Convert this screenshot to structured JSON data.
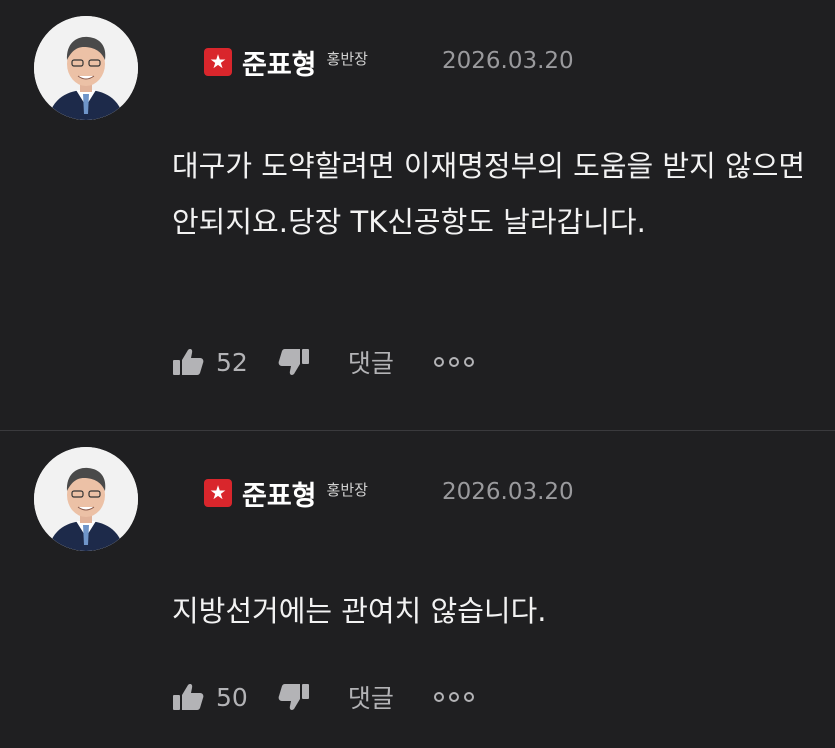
{
  "colors": {
    "background": "#1f1f21",
    "badge": "#d9262c",
    "muted": "#9a9a9d"
  },
  "comments": [
    {
      "author": "준표형",
      "nickname": "홍반장",
      "date": "2026.03.20",
      "badge_icon": "star-icon",
      "text": "대구가 도약할려면 이재명정부의 도움을 받지 않으면 안되지요.당장 TK신공항도 날라갑니다.",
      "likes": "52",
      "reply_label": "댓글"
    },
    {
      "author": "준표형",
      "nickname": "홍반장",
      "date": "2026.03.20",
      "badge_icon": "star-icon",
      "text": "지방선거에는 관여치 않습니다.",
      "likes": "50",
      "reply_label": "댓글"
    }
  ]
}
